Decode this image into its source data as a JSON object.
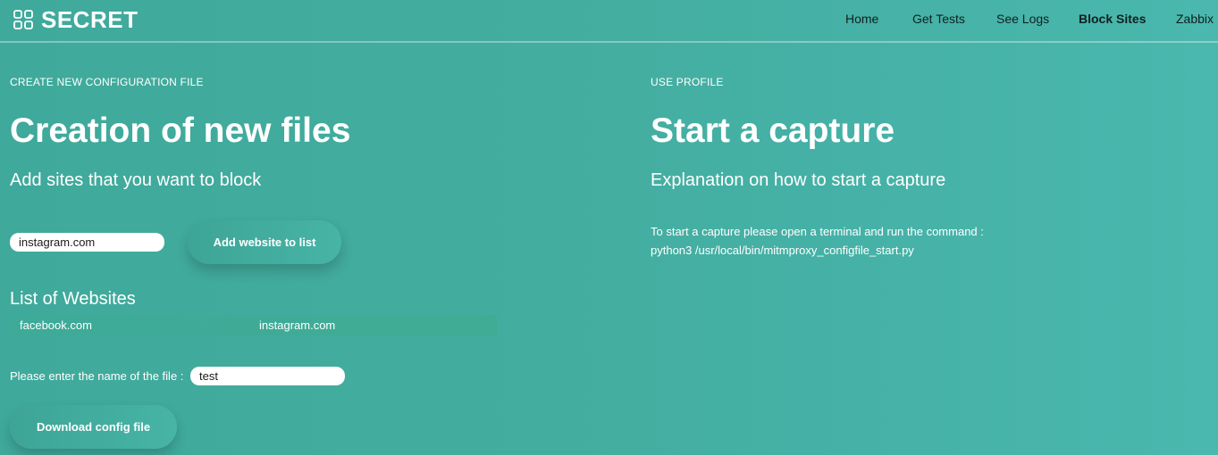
{
  "header": {
    "brand": "SECRET",
    "brand_icon": "grid-icon",
    "nav": [
      {
        "label": "Home",
        "active": false
      },
      {
        "label": "Get Tests",
        "active": false
      },
      {
        "label": "See Logs",
        "active": false
      },
      {
        "label": "Block Sites",
        "active": true
      },
      {
        "label": "Zabbix",
        "active": false
      }
    ]
  },
  "left": {
    "eyebrow": "CREATE NEW CONFIGURATION FILE",
    "title": "Creation of new files",
    "subtitle": "Add sites that you want to block",
    "site_input_value": "instagram.com",
    "add_button_label": "Add website to list",
    "list_title": "List of Websites",
    "websites": [
      "facebook.com",
      "instagram.com"
    ],
    "file_label": "Please enter the name of the file :",
    "file_input_value": "test",
    "download_button_label": "Download config file"
  },
  "right": {
    "eyebrow": "USE PROFILE",
    "title": "Start a capture",
    "subtitle": "Explanation on how to start a capture",
    "instruction_line1": "To start a capture please open a terminal and run the command :",
    "instruction_line2": "python3 /usr/local/bin/mitmproxy_configfile_start.py"
  },
  "colors": {
    "background": "#43ad9f",
    "nav_text": "#10201e",
    "button": "#44b0a2"
  }
}
